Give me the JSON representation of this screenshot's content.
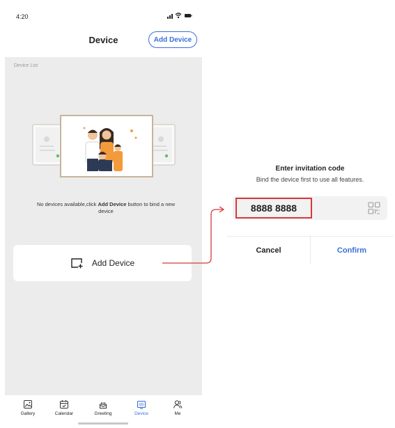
{
  "status_bar": {
    "time": "4:20"
  },
  "header": {
    "title": "Device",
    "add_device_label": "Add Device"
  },
  "device_list": {
    "section_label": "Device List",
    "empty_prefix": "No devices available,click ",
    "empty_bold": "Add Device",
    "empty_suffix": " button to bind a new device"
  },
  "add_card": {
    "label": "Add Device",
    "icon": "add-screen-icon"
  },
  "tab_bar": {
    "items": [
      {
        "label": "Gallery",
        "icon": "gallery-icon",
        "active": false
      },
      {
        "label": "Calendar",
        "icon": "calendar-icon",
        "active": false
      },
      {
        "label": "Greeting",
        "icon": "cake-icon",
        "active": false
      },
      {
        "label": "Device",
        "icon": "frame-icon",
        "active": true
      },
      {
        "label": "Me",
        "icon": "person-icon",
        "active": false
      }
    ]
  },
  "dialog": {
    "title": "Enter invitation code",
    "subtitle": "Bind the device first to use all features.",
    "code_value": "8888 8888",
    "qr_icon": "qr-code-icon",
    "cancel_label": "Cancel",
    "confirm_label": "Confirm"
  },
  "colors": {
    "accent": "#3a6fd8",
    "highlight": "#d83838",
    "background": "#ececec"
  }
}
